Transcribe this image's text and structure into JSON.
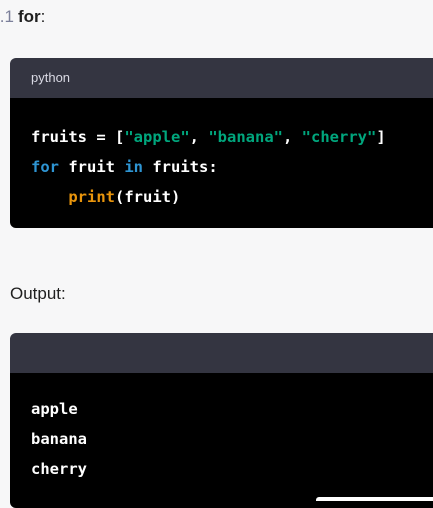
{
  "heading": {
    "marker": "1.",
    "keyword": "for",
    "colon": ":"
  },
  "code_block_1": {
    "language": "python",
    "lines": [
      [
        {
          "t": "fruits = [",
          "c": "plain"
        },
        {
          "t": "\"apple\"",
          "c": "str"
        },
        {
          "t": ", ",
          "c": "plain"
        },
        {
          "t": "\"banana\"",
          "c": "str"
        },
        {
          "t": ", ",
          "c": "plain"
        },
        {
          "t": "\"cherry\"",
          "c": "str"
        },
        {
          "t": "]",
          "c": "plain"
        }
      ],
      [
        {
          "t": "for",
          "c": "kw"
        },
        {
          "t": " fruit ",
          "c": "plain"
        },
        {
          "t": "in",
          "c": "kw"
        },
        {
          "t": " fruits:",
          "c": "plain"
        }
      ],
      [
        {
          "t": "    ",
          "c": "plain"
        },
        {
          "t": "print",
          "c": "fn"
        },
        {
          "t": "(fruit)",
          "c": "plain"
        }
      ]
    ]
  },
  "output_label": "Output:",
  "code_block_2": {
    "language": "",
    "lines": [
      "apple",
      "banana",
      "cherry"
    ]
  },
  "colors": {
    "string": "#00a67d",
    "keyword": "#2e95d3",
    "function": "#e9950c",
    "code_header_bg": "#343541",
    "code_body_bg": "#000000"
  }
}
